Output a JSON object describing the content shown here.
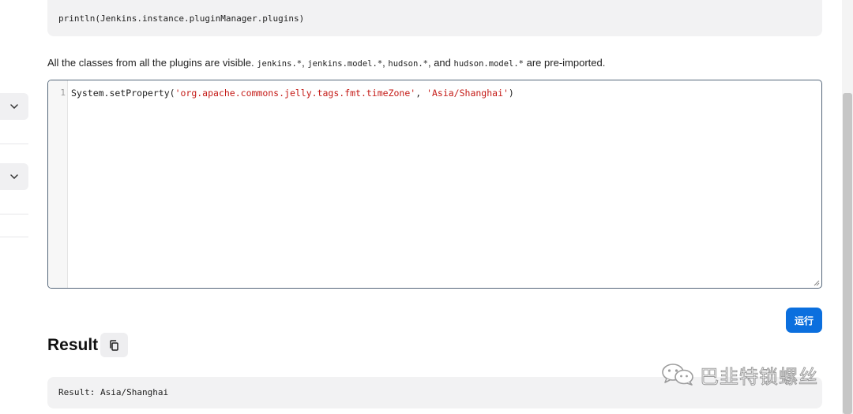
{
  "sidebar": {
    "collapse_icons": [
      "chevron-down-icon",
      "chevron-down-icon"
    ]
  },
  "example": {
    "code": "println(Jenkins.instance.pluginManager.plugins)"
  },
  "description": {
    "prefix": "All the classes from all the plugins are visible. ",
    "imports": [
      "jenkins.*",
      "jenkins.model.*",
      "hudson.*",
      "hudson.model.*"
    ],
    "sep1": ", ",
    "sep2": ", ",
    "sep3": ", and ",
    "suffix": " are pre-imported."
  },
  "editor": {
    "line_number": "1",
    "code_prefix": "System.setProperty(",
    "arg1": "'org.apache.commons.jelly.tags.fmt.timeZone'",
    "arg_sep": ", ",
    "arg2": "'Asia/Shanghai'",
    "code_suffix": ")"
  },
  "run_button": {
    "label": "运行"
  },
  "result": {
    "title": "Result",
    "copy_icon": "copy-icon",
    "output": "Result: Asia/Shanghai"
  },
  "watermark": {
    "icon": "wechat-icon",
    "text": "巴韭特锁螺丝"
  },
  "colors": {
    "accent": "#0b6fde",
    "string": "#c41a16",
    "editor_border": "#55677a"
  }
}
